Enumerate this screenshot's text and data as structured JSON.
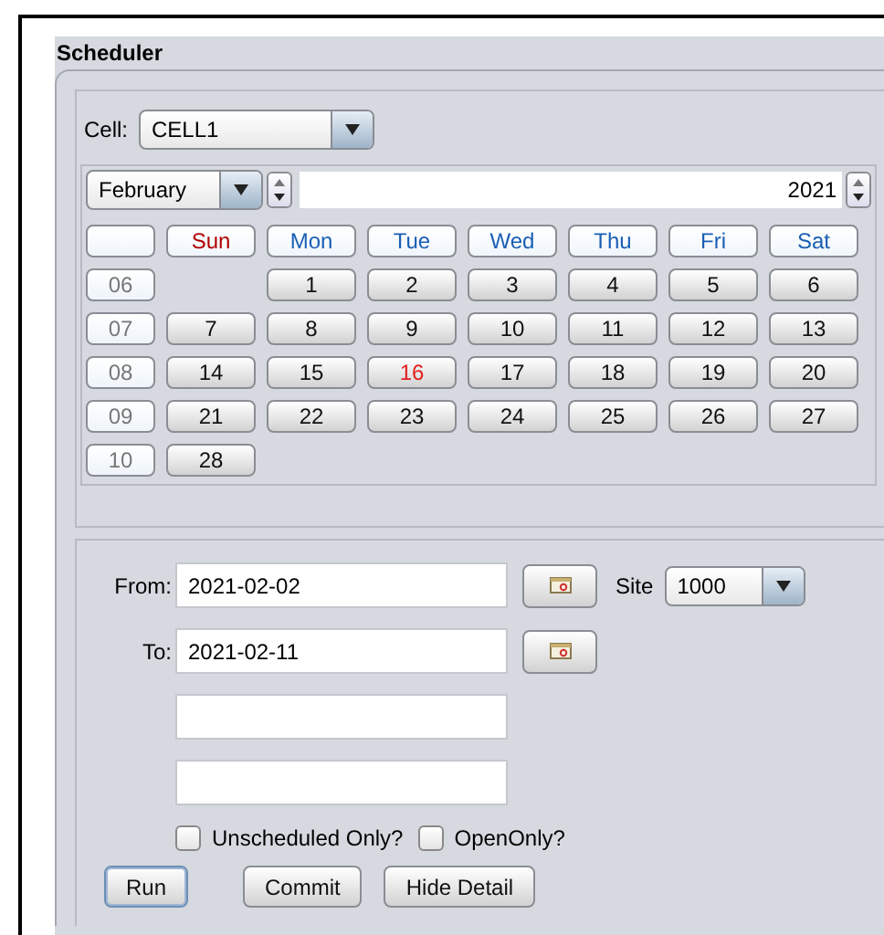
{
  "window": {
    "title": "Scheduler"
  },
  "cell": {
    "label": "Cell:",
    "value": "CELL1"
  },
  "calendar": {
    "month": "February",
    "year": "2021",
    "headers": [
      {
        "label": "Sun",
        "color": "#b00000"
      },
      {
        "label": "Mon",
        "color": "#1a5fb4"
      },
      {
        "label": "Tue",
        "color": "#1a5fb4"
      },
      {
        "label": "Wed",
        "color": "#1a5fb4"
      },
      {
        "label": "Thu",
        "color": "#1a5fb4"
      },
      {
        "label": "Fri",
        "color": "#1a5fb4"
      },
      {
        "label": "Sat",
        "color": "#1a5fb4"
      }
    ],
    "weeks": [
      {
        "week": "06",
        "days": [
          {
            "kind": "blank"
          },
          {
            "day": "1",
            "today": false
          },
          {
            "day": "2",
            "today": false
          },
          {
            "day": "3",
            "today": false
          },
          {
            "day": "4",
            "today": false
          },
          {
            "day": "5",
            "today": false
          },
          {
            "day": "6",
            "today": false
          }
        ]
      },
      {
        "week": "07",
        "days": [
          {
            "day": "7",
            "today": false
          },
          {
            "day": "8",
            "today": false
          },
          {
            "day": "9",
            "today": false
          },
          {
            "day": "10",
            "today": false
          },
          {
            "day": "11",
            "today": false
          },
          {
            "day": "12",
            "today": false
          },
          {
            "day": "13",
            "today": false
          }
        ]
      },
      {
        "week": "08",
        "days": [
          {
            "day": "14",
            "today": false
          },
          {
            "day": "15",
            "today": false
          },
          {
            "day": "16",
            "today": true
          },
          {
            "day": "17",
            "today": false
          },
          {
            "day": "18",
            "today": false
          },
          {
            "day": "19",
            "today": false
          },
          {
            "day": "20",
            "today": false
          }
        ]
      },
      {
        "week": "09",
        "days": [
          {
            "day": "21",
            "today": false
          },
          {
            "day": "22",
            "today": false
          },
          {
            "day": "23",
            "today": false
          },
          {
            "day": "24",
            "today": false
          },
          {
            "day": "25",
            "today": false
          },
          {
            "day": "26",
            "today": false
          },
          {
            "day": "27",
            "today": false
          }
        ]
      },
      {
        "week": "10",
        "days": [
          {
            "day": "28",
            "today": false
          }
        ]
      }
    ]
  },
  "from": {
    "label": "From:",
    "value": "2021-02-02"
  },
  "site": {
    "label": "Site",
    "value": "1000"
  },
  "to": {
    "label": "To:",
    "value": "2021-02-11"
  },
  "checkboxes": [
    {
      "label": "Unscheduled Only?",
      "checked": false
    },
    {
      "label": "OpenOnly?",
      "checked": false
    }
  ],
  "buttons": [
    {
      "label": "Run",
      "focused": true
    },
    {
      "label": "Commit",
      "focused": false
    },
    {
      "label": "Hide Detail",
      "focused": false
    }
  ]
}
